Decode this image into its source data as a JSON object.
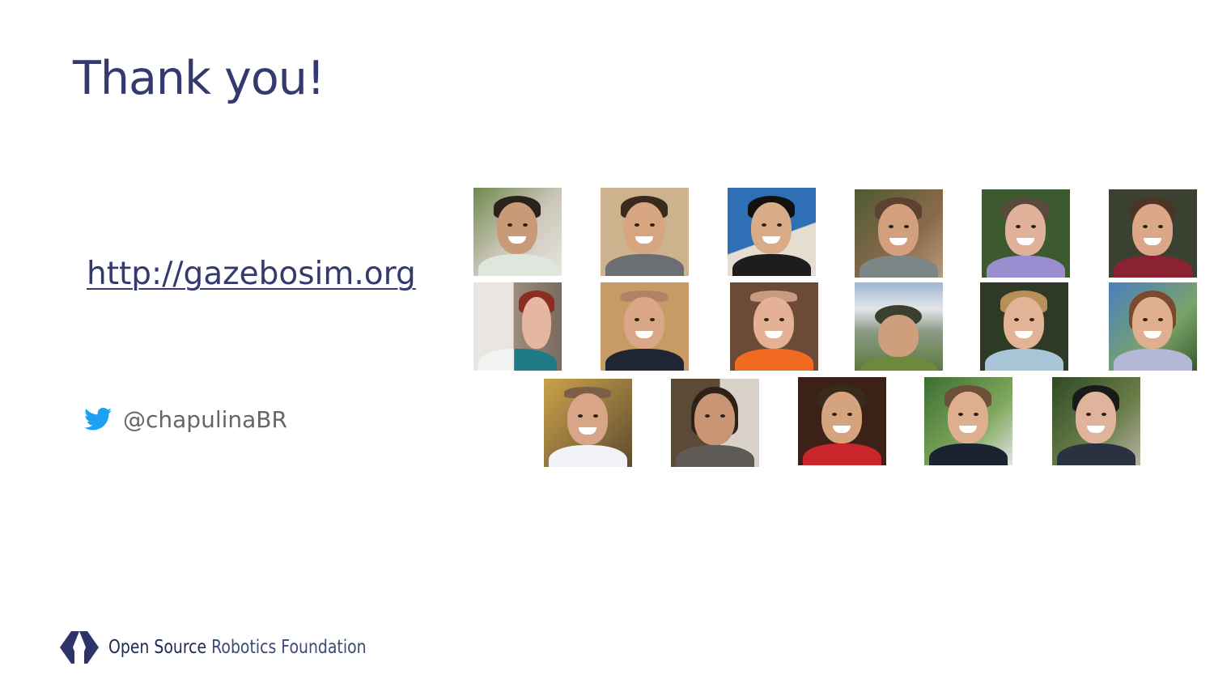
{
  "slide": {
    "title": "Thank you!",
    "link_text": "http://gazebosim.org",
    "twitter_handle": "@chapulinaBR",
    "twitter_icon": "twitter-bird-icon",
    "accent_color": "#343a6e",
    "twitter_color": "#1da1f2"
  },
  "logo": {
    "icon": "osrf-logo-icon",
    "part1": "Open Source",
    "part2": "Robotics Foundation"
  },
  "contributors": {
    "count": 17,
    "rows": [
      6,
      6,
      5
    ]
  }
}
